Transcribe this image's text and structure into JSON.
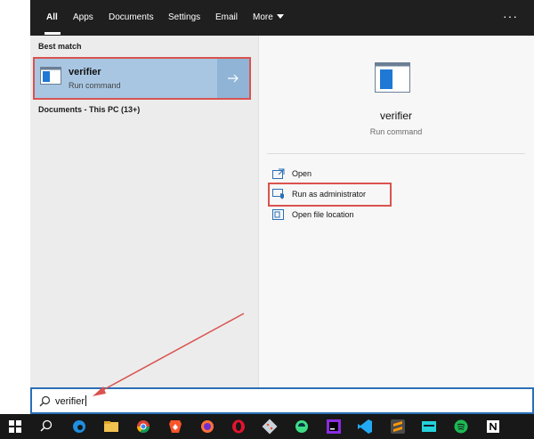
{
  "tabs": [
    {
      "label": "All"
    },
    {
      "label": "Apps"
    },
    {
      "label": "Documents"
    },
    {
      "label": "Settings"
    },
    {
      "label": "Email"
    },
    {
      "label": "More"
    }
  ],
  "menu_dots": "···",
  "best_match": {
    "heading": "Best match",
    "title": "verifier",
    "subtitle": "Run command"
  },
  "documents_heading": "Documents - This PC (13+)",
  "detail": {
    "title": "verifier",
    "subtitle": "Run command",
    "actions": [
      {
        "label": "Open"
      },
      {
        "label": "Run as administrator"
      },
      {
        "label": "Open file location"
      }
    ]
  },
  "search": {
    "value": "verifier"
  },
  "colors": {
    "accent": "#2b6fb6",
    "highlight": "#d9534f",
    "selected": "#a8c6e2"
  },
  "taskbar_icons": [
    "windows-start-icon",
    "search-icon",
    "edge-icon",
    "file-explorer-icon",
    "chrome-icon",
    "brave-icon",
    "firefox-icon",
    "opera-icon",
    "git-icon",
    "android-studio-icon",
    "jetbrains-icon",
    "vscode-icon",
    "sublime-icon",
    "amazon-music-icon",
    "spotify-icon",
    "notion-icon"
  ]
}
